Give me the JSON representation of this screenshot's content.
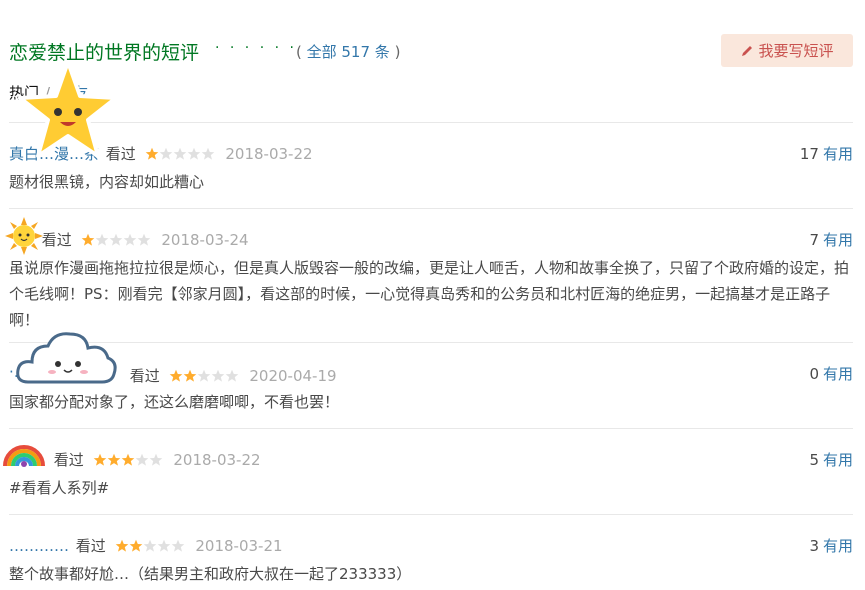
{
  "header": {
    "title": "恋爱禁止的世界的短评",
    "dots": "· · · · · ·",
    "total_open": "( ",
    "total_label": "全部 517 条",
    "total_close": " )",
    "write_button": "我要写短评"
  },
  "tabs": {
    "hot": "热门",
    "sep": "/",
    "friends": "好友"
  },
  "colors": {
    "title": "#007722",
    "link": "#3377aa",
    "star_on": "#ffac2d",
    "star_off": "#e0e0e0",
    "button_bg": "#fae7dc",
    "button_text": "#c9524f"
  },
  "reviews": [
    {
      "user": "真白…漫…茶",
      "status": "看过",
      "rating": 1,
      "date": "2018-03-22",
      "votes": "17",
      "useful": "有用",
      "content": "题材很黑镜，内容却如此糟心"
    },
    {
      "user": "",
      "status": "看过",
      "rating": 1,
      "date": "2018-03-24",
      "votes": "7",
      "useful": "有用",
      "content": "虽说原作漫画拖拖拉拉很是烦心，但是真人版毁容一般的改编，更是让人咂舌，人物和故事全换了，只留了个政府婚的设定，拍个毛线啊！PS：刚看完【邻家月圆】，看这部的时候，一心觉得真岛秀和的公务员和北村匠海的绝症男，一起搞基才是正路子啊！"
    },
    {
      "user": "·…………",
      "status": "看过",
      "rating": 2,
      "date": "2020-04-19",
      "votes": "0",
      "useful": "有用",
      "content": "国家都分配对象了，还这么磨磨唧唧，不看也罢！"
    },
    {
      "user": "",
      "status": "看过",
      "rating": 3,
      "date": "2018-03-22",
      "votes": "5",
      "useful": "有用",
      "content": "#看看人系列#"
    },
    {
      "user": "…………",
      "status": "看过",
      "rating": 2,
      "date": "2018-03-21",
      "votes": "3",
      "useful": "有用",
      "content": "整个故事都好尬…（结果男主和政府大叔在一起了233333）"
    }
  ]
}
